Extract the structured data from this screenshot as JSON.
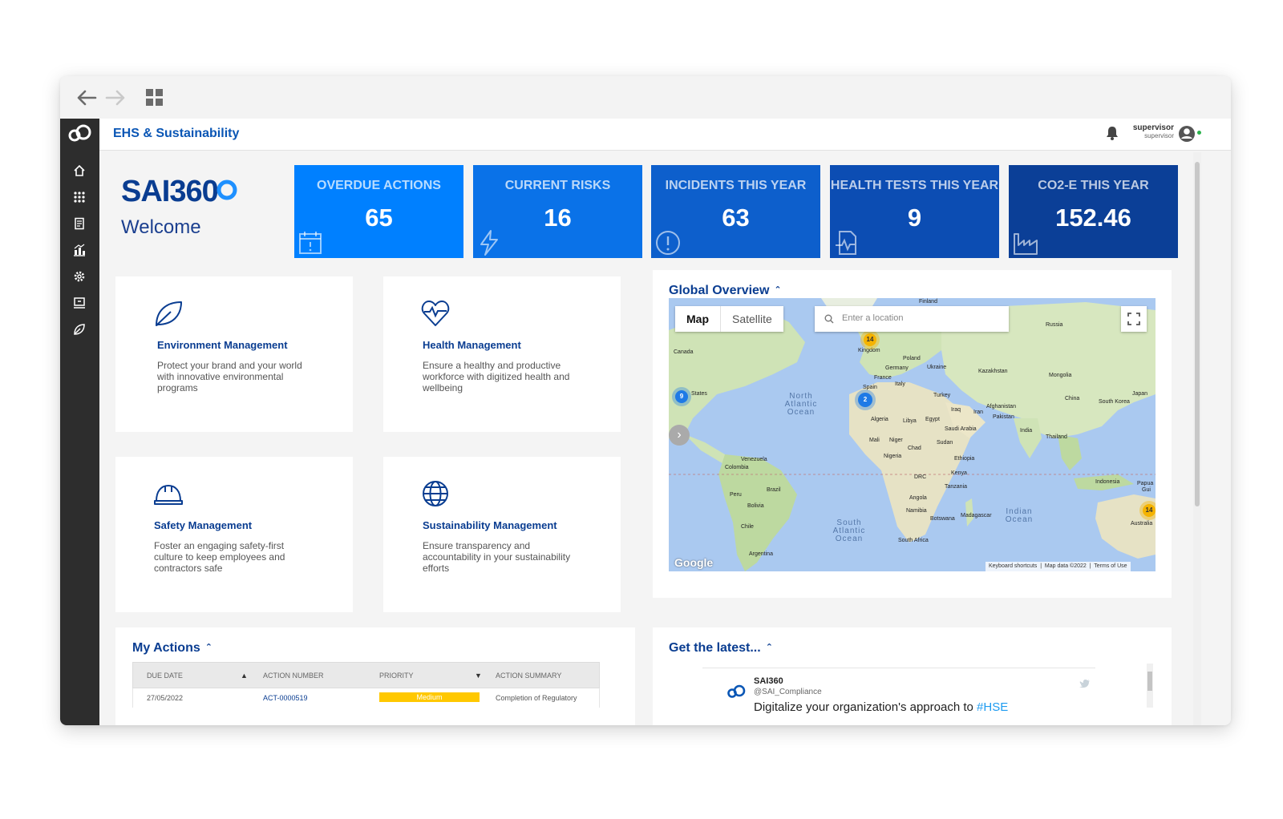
{
  "app": {
    "title": "EHS & Sustainability"
  },
  "user": {
    "name": "supervisor",
    "role": "supervisor"
  },
  "brand": {
    "logo_text": "SAI360",
    "welcome": "Welcome"
  },
  "kpis": [
    {
      "label": "OVERDUE ACTIONS",
      "value": "65",
      "icon": "calendar-alert-icon",
      "color": "#0080ff"
    },
    {
      "label": "CURRENT RISKS",
      "value": "16",
      "icon": "lightning-icon",
      "color": "#0a72e8"
    },
    {
      "label": "INCIDENTS THIS YEAR",
      "value": "63",
      "icon": "exclamation-circle-icon",
      "color": "#0d5fcc"
    },
    {
      "label": "HEALTH TESTS THIS YEAR",
      "value": "9",
      "icon": "health-document-icon",
      "color": "#0c4db3"
    },
    {
      "label": "CO2-E THIS YEAR",
      "value": "152.46",
      "icon": "factory-icon",
      "color": "#0b3f97"
    }
  ],
  "modules": [
    {
      "title": "Environment Management",
      "desc": "Protect your brand and your world with innovative environmental programs",
      "icon": "leaf-icon"
    },
    {
      "title": "Health Management",
      "desc": "Ensure a healthy and productive workforce with digitized health and wellbeing",
      "icon": "heart-pulse-icon"
    },
    {
      "title": "Safety Management",
      "desc": "Foster an engaging safety-first culture to keep employees and contractors safe",
      "icon": "hard-hat-icon"
    },
    {
      "title": "Sustainability Management",
      "desc": "Ensure transparency and accountability in your sustainability efforts",
      "icon": "globe-icon"
    }
  ],
  "global_overview": {
    "title": "Global Overview",
    "map_tab": "Map",
    "satellite_tab": "Satellite",
    "search_placeholder": "Enter a location",
    "footer_shortcuts": "Keyboard shortcuts",
    "footer_data": "Map data ©2022",
    "footer_terms": "Terms of Use",
    "watermark": "Google",
    "oceans": [
      "North Atlantic Ocean",
      "South Atlantic Ocean",
      "Indian Ocean"
    ],
    "clusters": [
      {
        "count": "14",
        "color": "yellow"
      },
      {
        "count": "9",
        "color": "blue"
      },
      {
        "count": "2",
        "color": "blue"
      },
      {
        "count": "14",
        "color": "yellow"
      }
    ],
    "labels": [
      "Finland",
      "Russia",
      "Canada",
      "Kingdom",
      "Poland",
      "Germany",
      "Ukraine",
      "Kazakhstan",
      "France",
      "Italy",
      "Mongolia",
      "Spain",
      "Turkey",
      "Japan",
      "States",
      "China",
      "South Korea",
      "Algeria",
      "Libya",
      "Egypt",
      "Iraq",
      "Iran",
      "Afghanistan",
      "Pakistan",
      "Saudi Arabia",
      "India",
      "Mali",
      "Niger",
      "Chad",
      "Sudan",
      "Thailand",
      "Nigeria",
      "Ethiopia",
      "Venezuela",
      "Colombia",
      "Kenya",
      "DRC",
      "Tanzania",
      "Indonesia",
      "Peru",
      "Brazil",
      "Angola",
      "Bolivia",
      "Namibia",
      "Botswana",
      "Madagascar",
      "Chile",
      "South Africa",
      "Argentina",
      "Australia",
      "Papua",
      "Gui"
    ]
  },
  "my_actions": {
    "title": "My Actions",
    "columns": [
      "DUE DATE",
      "ACTION NUMBER",
      "PRIORITY",
      "ACTION SUMMARY"
    ],
    "rows": [
      {
        "due": "27/05/2022",
        "number": "ACT-0000519",
        "priority": "Medium",
        "summary": "Completion of Regulatory"
      }
    ]
  },
  "latest": {
    "title": "Get the latest...",
    "account": "SAI360",
    "handle": "@SAI_Compliance",
    "text": "Digitalize your organization's approach to",
    "hashtag": "#HSE"
  }
}
